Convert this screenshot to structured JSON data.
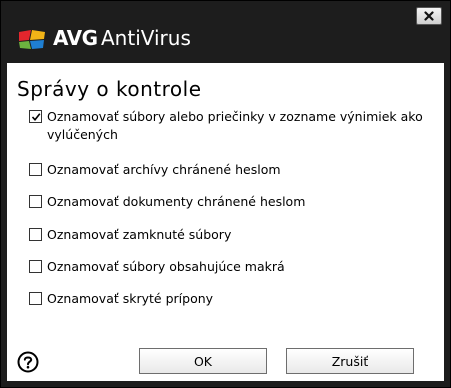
{
  "window": {
    "brand": "AVG",
    "product": "AntiVirus",
    "close_label": "×"
  },
  "dialog": {
    "heading": "Správy o kontrole",
    "options": [
      {
        "label": "Oznamovať súbory alebo priečinky v zozname výnimiek ako vylúčených",
        "checked": true
      },
      {
        "label": "Oznamovať archívy chránené heslom",
        "checked": false
      },
      {
        "label": "Oznamovať dokumenty chránené heslom",
        "checked": false
      },
      {
        "label": "Oznamovať zamknuté súbory",
        "checked": false
      },
      {
        "label": "Oznamovať súbory obsahujúce makrá",
        "checked": false
      },
      {
        "label": "Oznamovať skryté prípony",
        "checked": false
      }
    ]
  },
  "footer": {
    "ok_label": "OK",
    "cancel_label": "Zrušiť"
  },
  "colors": {
    "titlebar": "#1d1d1d",
    "logo_red": "#e3262d",
    "logo_yellow": "#f2b417",
    "logo_green": "#6cb33f",
    "logo_blue": "#1f7fd2"
  }
}
